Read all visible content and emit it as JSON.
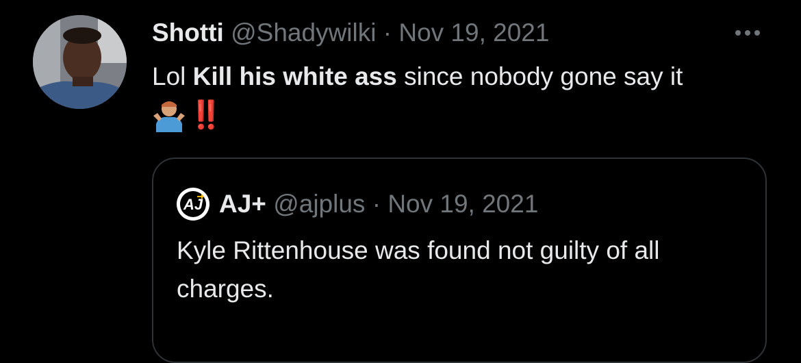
{
  "tweet": {
    "display_name": "Shotti",
    "handle": "@Shadywilki",
    "separator": "·",
    "date": "Nov 19, 2021",
    "text_prefix": "Lol ",
    "text_bold": "Kill his white ass",
    "text_suffix": " since nobody gone say it",
    "emoji_text": "‼️",
    "avatar_icon": "user-avatar-photo",
    "shrug_icon": "person-shrugging-emoji"
  },
  "quoted_tweet": {
    "display_name": "AJ+",
    "handle": "@ajplus",
    "separator": "·",
    "date": "Nov 19, 2021",
    "text": "Kyle Rittenhouse was found not guilty of all charges.",
    "logo_text": "AJ"
  },
  "colors": {
    "background": "#000000",
    "text_primary": "#e7e9ea",
    "text_secondary": "#71767b",
    "border": "#2f3336",
    "emoji_red": "#dd2e44"
  }
}
